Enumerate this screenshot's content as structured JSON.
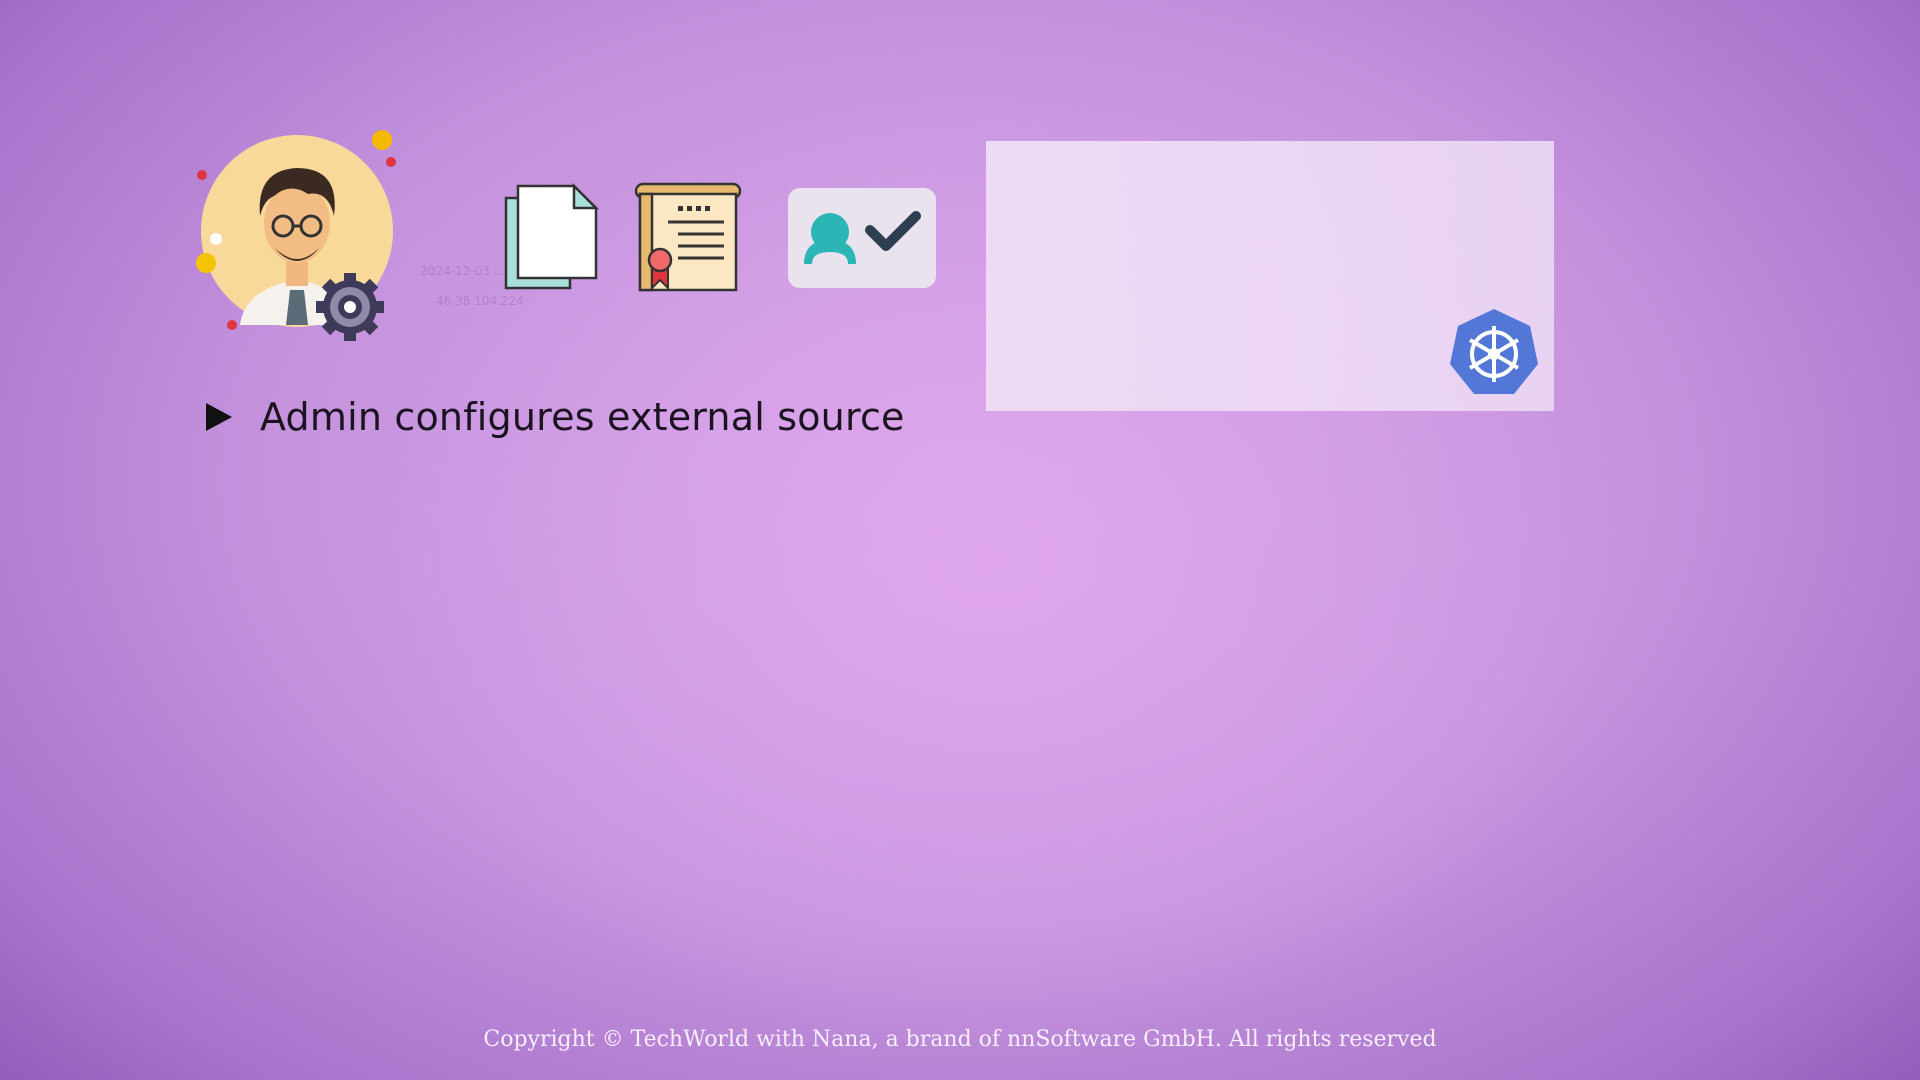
{
  "icons": {
    "avatar": "admin-avatar-with-gear",
    "document": "document-icon",
    "certificate": "certificate-icon",
    "user_verified": "user-check-icon",
    "kubernetes": "kubernetes-icon"
  },
  "watermark": {
    "line1": "2024-12-03 ...19",
    "line2": "46.38.104.224"
  },
  "bullet": {
    "text": "Admin configures external source"
  },
  "footer": {
    "copyright": "Copyright © TechWorld with Nana, a brand of nnSoftware GmbH. All rights reserved"
  },
  "colors": {
    "kubernetes_blue": "#5277d6",
    "user_teal": "#2bb5b5",
    "check_dark": "#2c3e50"
  }
}
